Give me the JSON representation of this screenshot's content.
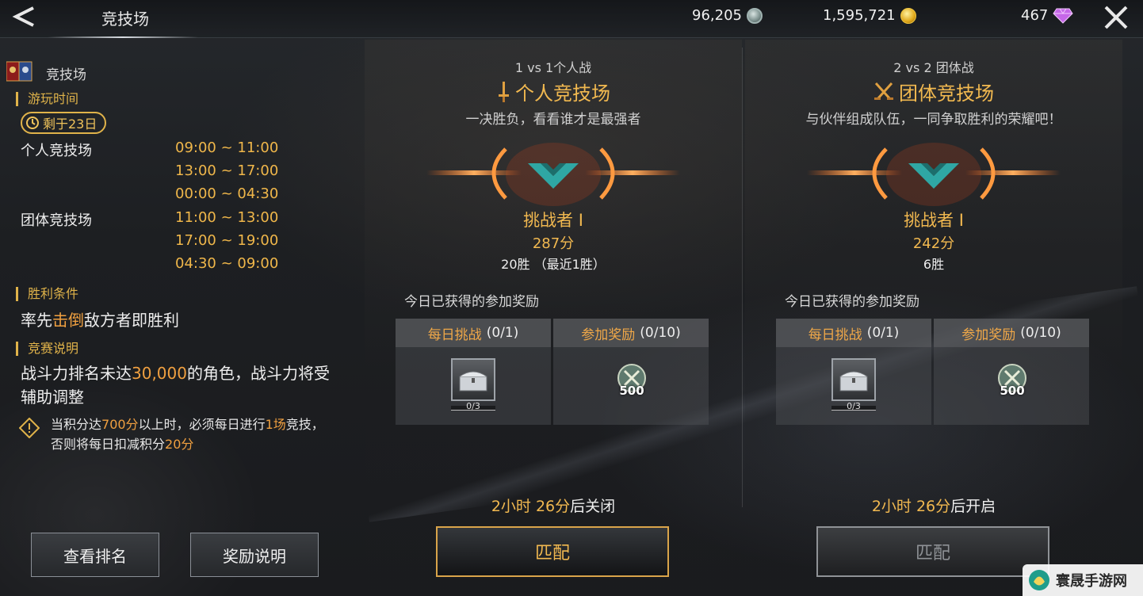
{
  "header": {
    "title": "竞技场",
    "currency_silver": "96,205",
    "currency_gold": "1,595,721",
    "currency_gem": "467"
  },
  "left": {
    "section_name": "竞技场",
    "play_time_label": "游玩时间",
    "remaining_badge": "剩于23日",
    "solo_label": "个人竞技场",
    "solo_times": [
      "09:00 ~ 11:00",
      "13:00 ~ 17:00",
      "00:00 ~ 04:30"
    ],
    "team_label": "团体竞技场",
    "team_times": [
      "11:00 ~ 13:00",
      "17:00 ~ 19:00",
      "04:30 ~ 09:00"
    ],
    "win_label": "胜利条件",
    "win_prefix": "率先",
    "win_highlight": "击倒",
    "win_suffix": "敌方者即胜利",
    "desc_label": "竞赛说明",
    "desc_prefix": "战斗力排名未达",
    "desc_highlight": "30,000",
    "desc_suffix": "的角色，战斗力将受辅助调整",
    "warn_part1": "当积分达",
    "warn_hl1": "700分",
    "warn_part2": "以上时，必须每日进行",
    "warn_hl2": "1场",
    "warn_part3": "竞技，否则将每日扣减积分",
    "warn_hl3": "20分",
    "ranking_button": "查看排名",
    "reward_info_button": "奖励说明"
  },
  "solo": {
    "mode": "1 vs 1个人战",
    "title": "个人竞技场",
    "subtitle": "一决胜负，看看谁才是最强者",
    "rank": "挑战者 I",
    "score": "287分",
    "wins": "20胜 （最近1胜）",
    "rewards_title": "今日已获得的参加奖励",
    "daily_name": "每日挑战",
    "daily_count": "(0/1)",
    "daily_chest_count": "0/3",
    "part_name": "参加奖励",
    "part_count": "(0/10)",
    "part_value": "500",
    "status_time": "2小时 26分",
    "status_suffix": "后关闭",
    "match_button": "匹配"
  },
  "team": {
    "mode": "2 vs 2 团体战",
    "title": "团体竞技场",
    "subtitle": "与伙伴组成队伍，一同争取胜利的荣耀吧！",
    "rank": "挑战者 I",
    "score": "242分",
    "wins": "6胜",
    "rewards_title": "今日已获得的参加奖励",
    "daily_name": "每日挑战",
    "daily_count": "(0/1)",
    "daily_chest_count": "0/3",
    "part_name": "参加奖励",
    "part_count": "(0/10)",
    "part_value": "500",
    "status_time": "2小时 26分",
    "status_suffix": "后开启",
    "match_button": "匹配"
  },
  "watermark": {
    "text": "寰晟手游网"
  },
  "colors": {
    "accent_gold": "#f2b950",
    "highlight_orange": "#f0a040",
    "emblem_teal": "#2fa7a4"
  }
}
